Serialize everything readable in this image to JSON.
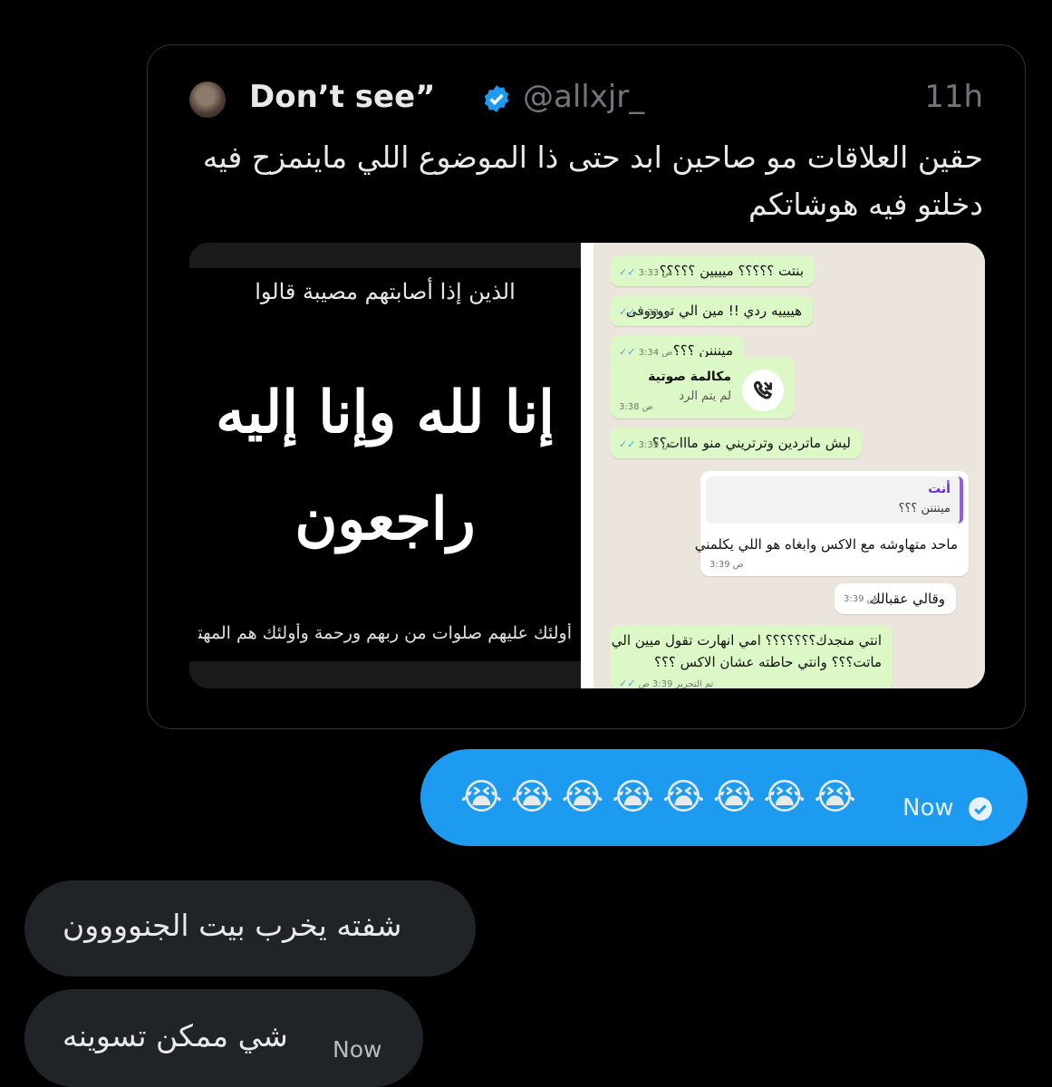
{
  "quote": {
    "author_name": "Don’t see”",
    "handle": "@allxjr_",
    "time": "11h",
    "text": "حقين العلاقات مو صاحين ابد حتى ذا الموضوع اللي ماينمزح فيه دخلتو فيه هوشاتكم"
  },
  "condolence": {
    "line1": "الذين إذا أصابتهم مصيبة قالوا",
    "main1": "إنا لله وإنا إليه",
    "main2": "راجعون",
    "line3": "أولئك عليهم صلوات من ربهم ورحمة وأولئك هم المهتدون"
  },
  "whatsapp": {
    "messages": [
      {
        "text": "بنتت ؟؟؟؟؟ ميييين ؟؟؟؟؟",
        "time": "3:33 ص"
      },
      {
        "text": "هييييه ردي !! مين الي تووووفى",
        "time": "3:33 ص"
      },
      {
        "text": "مينننن ؟؟؟",
        "time": "3:34 ص"
      },
      {
        "text": "ليش ماتردين وترتريني منو مااات؟؟",
        "time": "3:39 ص"
      },
      {
        "text": "انتي منجدك؟؟؟؟؟؟؟ امي انهارت تقول ميين الي",
        "text2": "ماتت؟؟؟ وانتي حاطته عشان الاكس ؟؟؟",
        "time": "تم التحرير 3:39 ص"
      }
    ],
    "call": {
      "title": "مكالمة صوتية",
      "subtitle": "لم يتم الرد",
      "time": "3:38 ص"
    },
    "reply": {
      "who": "أنت",
      "quoted": "مينننن ؟؟؟",
      "text": "ماحد متهاوشه مع الاكس وابغاه هو اللي يكلمني",
      "time": "3:39 ص"
    },
    "incoming2": {
      "text": "وقالي عقبالك",
      "time": "3:39 ص"
    }
  },
  "sent": {
    "emojis": "😭😭😭😭😭😭😭😭",
    "time": "Now"
  },
  "received": [
    {
      "text": "شفته يخرب بيت الجنوووون"
    },
    {
      "text": "شي ممكن تسوينه",
      "time": "Now"
    }
  ],
  "colors": {
    "accent": "#1d9bf0",
    "received_bg": "#202327",
    "border": "#2f3336"
  }
}
